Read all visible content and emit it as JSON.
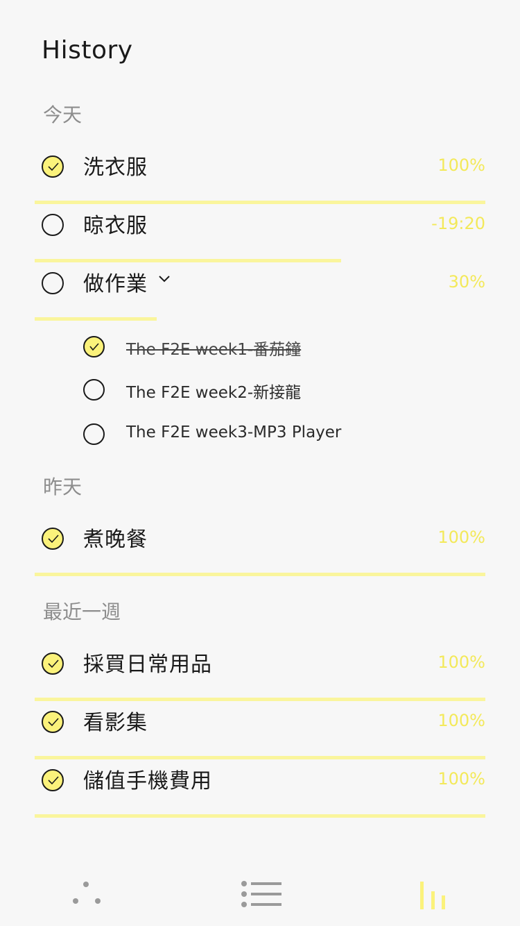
{
  "header": {
    "title": "History"
  },
  "colors": {
    "accent": "#fbf27b",
    "track": "#faf59c",
    "value_text": "#f3e95a",
    "muted": "#8d8d8d"
  },
  "sections": {
    "today": {
      "label": "今天",
      "tasks": [
        {
          "title": "洗衣服",
          "value": "100%",
          "done": true,
          "progress": 1.0
        },
        {
          "title": "晾衣服",
          "value": "-19:20",
          "done": false,
          "progress": 0.68
        },
        {
          "title": "做作業",
          "value": "30%",
          "done": false,
          "progress": 0.27,
          "expanded": true,
          "subtasks": [
            {
              "title": "The F2E week1-番茄鐘",
              "done": true
            },
            {
              "title": "The F2E week2-新接龍",
              "done": false
            },
            {
              "title": "The F2E week3-MP3 Player",
              "done": false
            }
          ]
        }
      ]
    },
    "yesterday": {
      "label": "昨天",
      "tasks": [
        {
          "title": "煮晚餐",
          "value": "100%",
          "done": true,
          "progress": 1.0
        }
      ]
    },
    "week": {
      "label": "最近一週",
      "tasks": [
        {
          "title": "採買日常用品",
          "value": "100%",
          "done": true,
          "progress": 1.0
        },
        {
          "title": "看影集",
          "value": "100%",
          "done": true,
          "progress": 1.0
        },
        {
          "title": "儲值手機費用",
          "value": "100%",
          "done": true,
          "progress": 1.0
        }
      ]
    }
  },
  "bottom_nav": {
    "items": [
      {
        "icon": "dots-icon",
        "active": false
      },
      {
        "icon": "list-icon",
        "active": false
      },
      {
        "icon": "bar-chart-icon",
        "active": true
      }
    ]
  }
}
